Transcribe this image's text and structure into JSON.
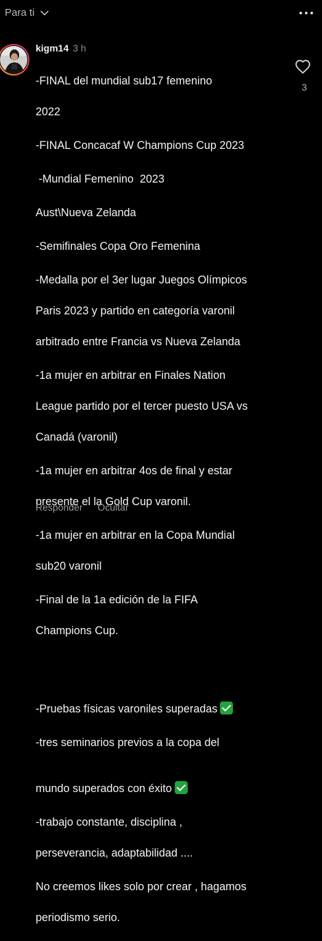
{
  "header": {
    "feed_label": "Para ti",
    "dropdown_icon": "chevron-down-icon",
    "more_icon": "more-dots-icon"
  },
  "comment": {
    "username": "kigm14",
    "time": "3 h",
    "like_icon": "heart-icon",
    "like_count": "3",
    "lines": [
      "-FINAL del mundial sub17 femenino",
      "2022",
      "-FINAL Concacaf  W Champions Cup 2023",
      " -Mundial Femenino  2023",
      "Aust\\Nueva Zelanda",
      "-Semifinales Copa Oro Femenina",
      "-Medalla por el 3er lugar Juegos Olímpicos",
      "Paris 2023 y partido en categoría varonil",
      "arbitrado entre Francia vs Nueva Zelanda",
      "-1a mujer en arbitrar en Finales Nation",
      "League partido por el tercer puesto USA vs",
      "Canadá (varonil)",
      "-1a mujer en arbitrar 4os de final y estar",
      "presente el la Gold Cup varonil.",
      "-1a mujer en arbitrar en la Copa Mundial",
      "sub20 varonil",
      "-Final de la 1a edición de la FIFA",
      "Champions Cup.",
      "",
      "-Pruebas  físicas varoniles superadas",
      "-tres seminarios previos a la copa del",
      "mundo superados con éxito",
      "-trabajo constante, disciplina ,",
      "perseverancia, adaptabilidad ....",
      "No creemos likes solo por crear , hagamos",
      "periodismo serio."
    ],
    "check_icon": "check-mark-emoji-icon",
    "actions": {
      "reply": "Responder",
      "hide": "Ocultar"
    }
  },
  "colors": {
    "background": "#000000",
    "text": "#f5f5f5",
    "muted": "#8e8e8e",
    "check": "#22a33b",
    "avatar_ring_start": "#f9b233",
    "avatar_ring_end": "#d62976"
  }
}
